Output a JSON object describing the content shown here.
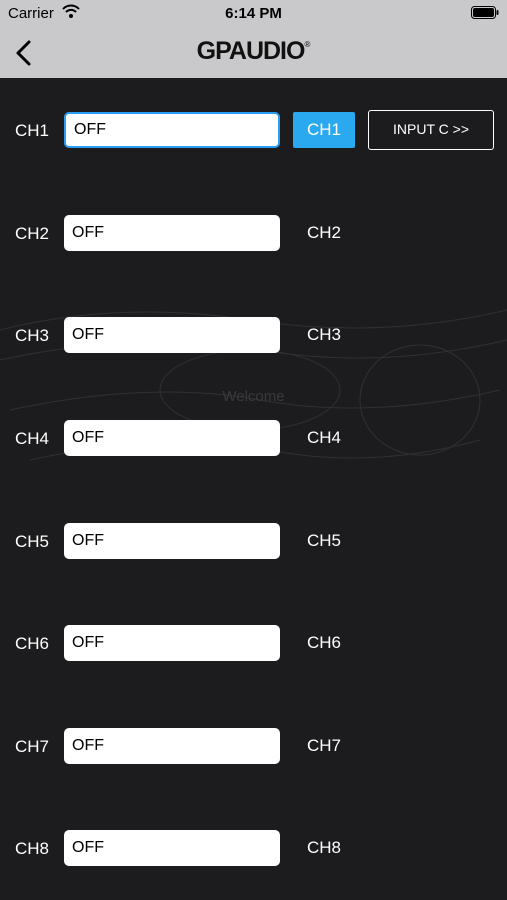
{
  "status": {
    "carrier": "Carrier",
    "time": "6:14 PM"
  },
  "nav": {
    "logo": "GPAUDIO",
    "reg": "®"
  },
  "watermark": {
    "text": "Welcome"
  },
  "input_button": "INPUT C >>",
  "channels": [
    {
      "label": "CH1",
      "value": "OFF",
      "button": "CH1"
    },
    {
      "label": "CH2",
      "value": "OFF",
      "button": "CH2"
    },
    {
      "label": "CH3",
      "value": "OFF",
      "button": "CH3"
    },
    {
      "label": "CH4",
      "value": "OFF",
      "button": "CH4"
    },
    {
      "label": "CH5",
      "value": "OFF",
      "button": "CH5"
    },
    {
      "label": "CH6",
      "value": "OFF",
      "button": "CH6"
    },
    {
      "label": "CH7",
      "value": "OFF",
      "button": "CH7"
    },
    {
      "label": "CH8",
      "value": "OFF",
      "button": "CH8"
    }
  ],
  "colors": {
    "accent": "#2aa8f0",
    "background": "#1c1c1e",
    "navbar": "#c9c9cb"
  }
}
